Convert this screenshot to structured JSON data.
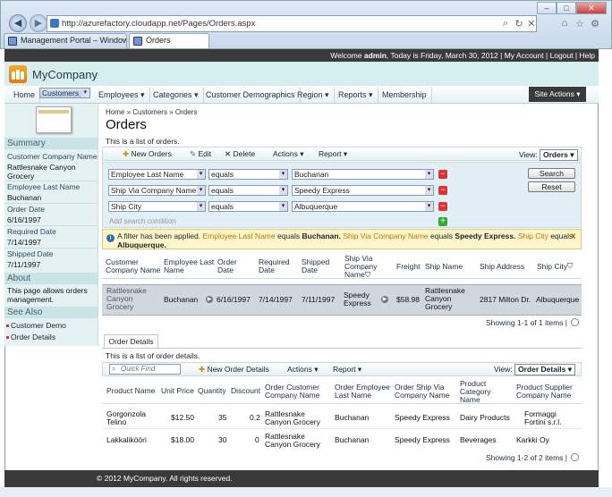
{
  "browser": {
    "url": "http://azurefactory.cloudapp.net/Pages/Orders.aspx",
    "url_domain": "azurefactory.cloudapp.net",
    "tabs": [
      {
        "label": "Management Portal – Window..."
      },
      {
        "label": "Orders"
      }
    ]
  },
  "topbar": {
    "text_prefix": "Welcome ",
    "user": "admin",
    "text_suffix": ", Today is Friday, March 30, 2012 | My Account | Logout | Help"
  },
  "brand": {
    "name": "MyCompany"
  },
  "menu": [
    "Home",
    "Customers ▾",
    "Employees ▾",
    "Categories ▾",
    "Customer Demographics",
    "Region ▾",
    "Reports ▾",
    "Membership"
  ],
  "site_actions": "Site Actions ▾",
  "sidebar": {
    "summary_title": "Summary",
    "fields": [
      {
        "label": "Customer Company Name",
        "value": "Rattlesnake Canyon Grocery"
      },
      {
        "label": "Employee Last Name",
        "value": "Buchanan"
      },
      {
        "label": "Order Date",
        "value": "6/16/1997"
      },
      {
        "label": "Required Date",
        "value": "7/14/1997"
      },
      {
        "label": "Shipped Date",
        "value": "7/11/1997"
      }
    ],
    "about_title": "About",
    "about_text": "This page allows orders management.",
    "seealso_title": "See Also",
    "links": [
      "Customer Demo",
      "Order Details"
    ]
  },
  "breadcrumb": {
    "home": "Home",
    "customers": "Customers",
    "current": "Orders",
    "sep": "»"
  },
  "page": {
    "title": "Orders",
    "description": "This is a list of orders."
  },
  "toolbar1": {
    "new": "New Orders",
    "edit": "Edit",
    "delete": "Delete",
    "actions": "Actions ▾",
    "report": "Report ▾",
    "view_label": "View:",
    "view_value": "Orders"
  },
  "filters": [
    {
      "field": "Employee Last Name",
      "op": "equals",
      "value": "Buchanan"
    },
    {
      "field": "Ship Via Company Name",
      "op": "equals",
      "value": "Speedy Express"
    },
    {
      "field": "Ship City",
      "op": "equals",
      "value": "Albuquerque"
    }
  ],
  "filter_add": "Add search condition",
  "buttons": {
    "search": "Search",
    "reset": "Reset"
  },
  "banner": {
    "prefix": "A filter has been applied.",
    "f1": "Employee Last Name",
    "eq": " equals ",
    "v1": "Buchanan.",
    "f2": "Ship Via Company Name",
    "v2": "Speedy Express.",
    "f3": "Ship City",
    "v3": "Albuquerque.",
    "close": "x"
  },
  "orders_grid": {
    "headers": [
      "Customer Company Name",
      "Employee Last Name",
      "Order Date",
      "Required Date",
      "Shipped Date",
      "Ship Via Company Name",
      "Freight",
      "Ship Name",
      "Ship Address",
      "Ship City"
    ],
    "row": {
      "customer": "Rattlesnake Canyon Grocery",
      "employee": "Buchanan",
      "order_date": "6/16/1997",
      "required": "7/14/1997",
      "shipped": "7/11/1997",
      "ship_via": "Speedy Express",
      "freight": "$58.98",
      "ship_name": "Rattlesnake Canyon Grocery",
      "address": "2817 Milton Dr.",
      "city": "Albuquerque"
    },
    "pager": "Showing 1-1 of 1 items |"
  },
  "details": {
    "tab": "Order Details",
    "description": "This is a list of order details.",
    "quickfind": "Quick Find",
    "new": "New Order Details",
    "actions": "Actions ▾",
    "report": "Report ▾",
    "view_label": "View:",
    "view_value": "Order Details",
    "headers": [
      "Product Name",
      "Unit Price",
      "Quantity",
      "Discount",
      "Order Customer Company Name",
      "Order Employee Last Name",
      "Order Ship Via Company Name",
      "Product Category Name",
      "Product Supplier Company Name"
    ],
    "rows": [
      {
        "product": "Gorgonzola Telino",
        "price": "$12.50",
        "qty": "35",
        "disc": "0.2",
        "cust": "Rattlesnake Canyon Grocery",
        "emp": "Buchanan",
        "via": "Speedy Express",
        "cat": "Dairy Products",
        "sup": "Formaggi Fortini s.r.l."
      },
      {
        "product": "Lakkalikööri",
        "price": "$18.00",
        "qty": "30",
        "disc": "0",
        "cust": "Rattlesnake Canyon Grocery",
        "emp": "Buchanan",
        "via": "Speedy Express",
        "cat": "Beverages",
        "sup": "Karkki Oy"
      }
    ],
    "pager": "Showing 1-2 of 2 items |"
  },
  "footer": "© 2012 MyCompany. All rights reserved."
}
